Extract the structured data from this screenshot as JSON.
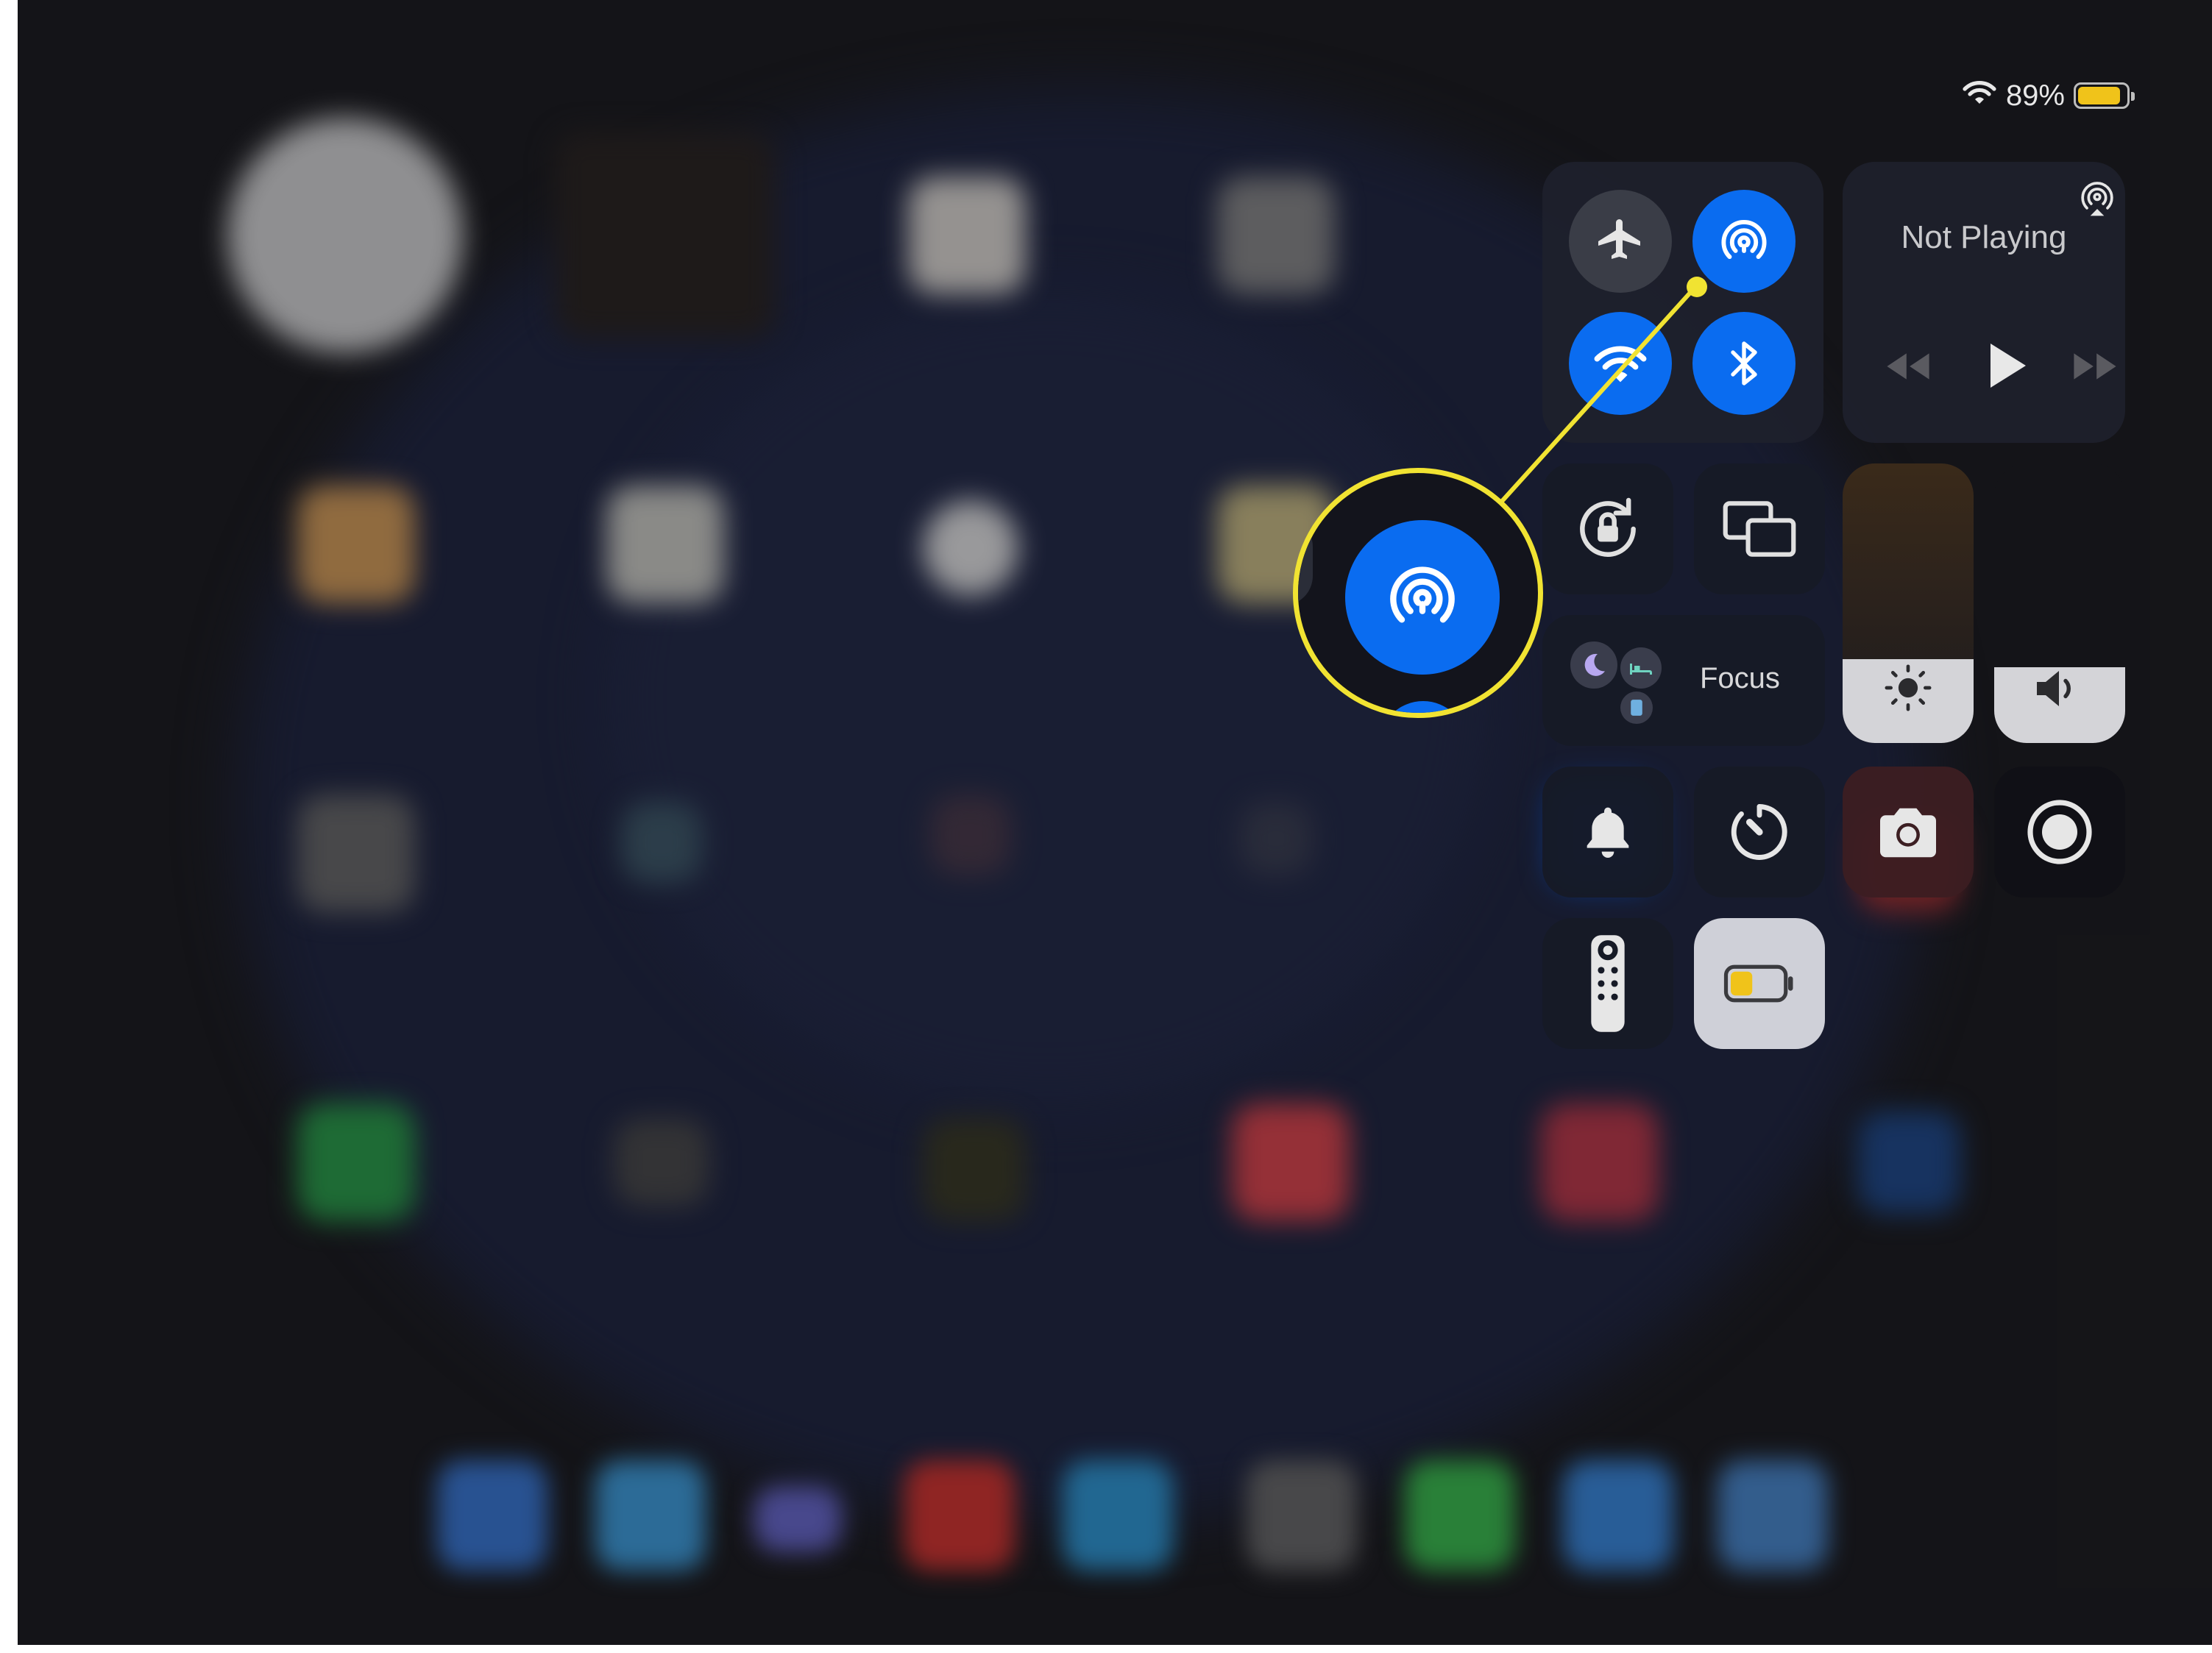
{
  "status_bar": {
    "battery_percent": "89%",
    "battery_level": 0.89,
    "battery_color": "#f0c31a"
  },
  "control_center": {
    "connectivity": {
      "airplane_mode": {
        "icon": "airplane-icon",
        "active": false
      },
      "airdrop": {
        "icon": "airdrop-icon",
        "active": true
      },
      "wifi": {
        "icon": "wifi-icon",
        "active": true
      },
      "bluetooth": {
        "icon": "bluetooth-icon",
        "active": true
      }
    },
    "now_playing": {
      "title": "Not Playing",
      "airplay_icon": "airplay-icon"
    },
    "focus": {
      "label": "Focus"
    },
    "brightness_level": 0.3,
    "volume_level": 0.27,
    "accent_color": "#0a6cf0",
    "callout_color": "#f1e332",
    "low_power_color": "#f0c31a"
  }
}
